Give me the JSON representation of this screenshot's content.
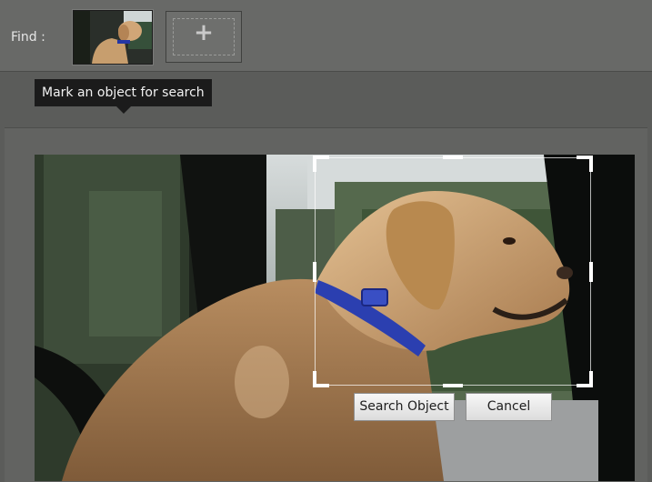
{
  "find": {
    "label": "Find :"
  },
  "thumbnail": {
    "name": "dog-thumbnail"
  },
  "add_slot": {
    "icon": "plus-icon",
    "glyph": "+"
  },
  "tooltip": {
    "text": "Mark an object for search"
  },
  "selection": {
    "search_button": "Search Object",
    "cancel_button": "Cancel"
  },
  "colors": {
    "background": "#5b5c5a",
    "topbar": "#686967",
    "tooltip": "#1b1b1b",
    "selection_border": "#ffffff"
  }
}
